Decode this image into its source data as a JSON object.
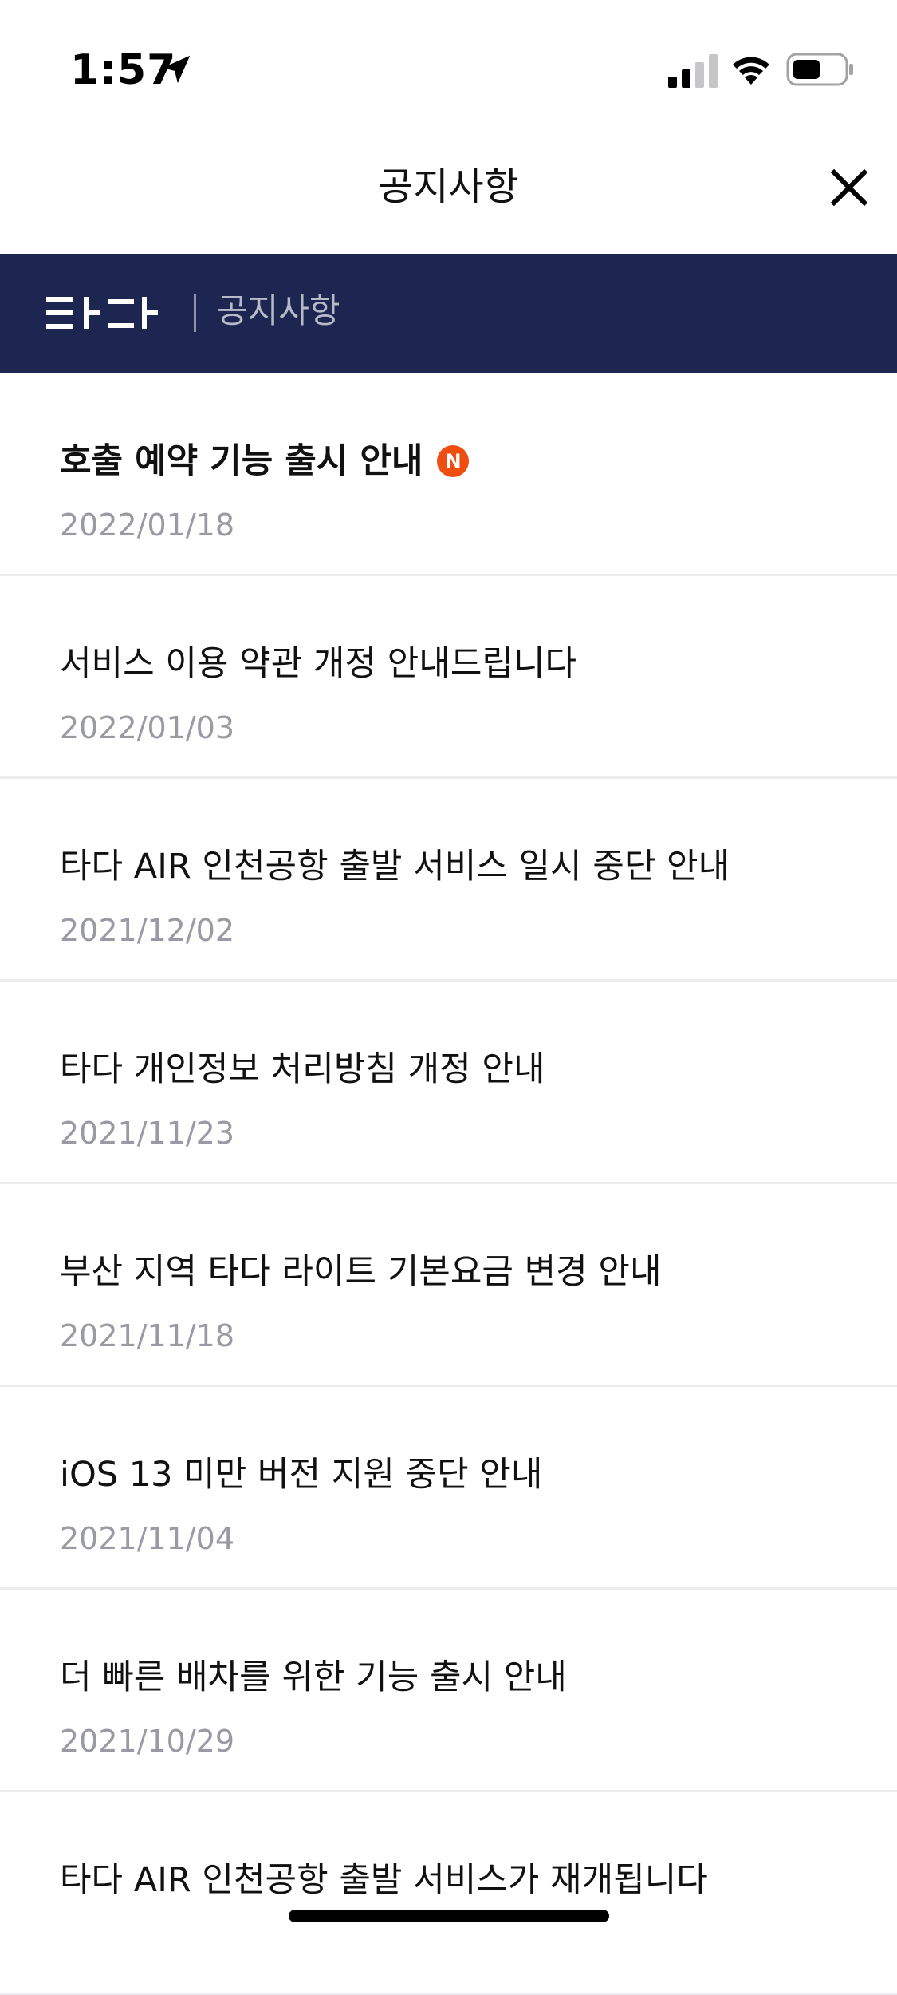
{
  "status_bar": {
    "time": "1:57",
    "icons": [
      "location-arrow-icon",
      "cellular-signal-icon",
      "wifi-icon",
      "battery-icon"
    ]
  },
  "nav": {
    "title": "공지사항",
    "close_icon": "close-icon"
  },
  "banner": {
    "brand_logo": "타다",
    "label": "공지사항",
    "background_color": "#1d2650"
  },
  "notices": [
    {
      "title": "호출 예약 기능 출시 안내",
      "date": "2022/01/18",
      "badge": "N",
      "emphasis": true
    },
    {
      "title": "서비스 이용 약관 개정 안내드립니다",
      "date": "2022/01/03"
    },
    {
      "title": "타다 AIR 인천공항 출발 서비스 일시 중단 안내",
      "date": "2021/12/02"
    },
    {
      "title": "타다 개인정보 처리방침 개정 안내",
      "date": "2021/11/23"
    },
    {
      "title": "부산 지역 타다 라이트 기본요금 변경 안내",
      "date": "2021/11/18"
    },
    {
      "title": "iOS 13 미만 버전 지원 중단 안내",
      "date": "2021/11/04"
    },
    {
      "title": "더 빠른 배차를 위한 기능 출시 안내",
      "date": "2021/10/29"
    },
    {
      "title": "타다 AIR 인천공항 출발 서비스가 재개됩니다",
      "date": ""
    }
  ],
  "colors": {
    "badge": "#f04e10",
    "date_text": "#9a9aa4",
    "divider": "#ececee"
  }
}
